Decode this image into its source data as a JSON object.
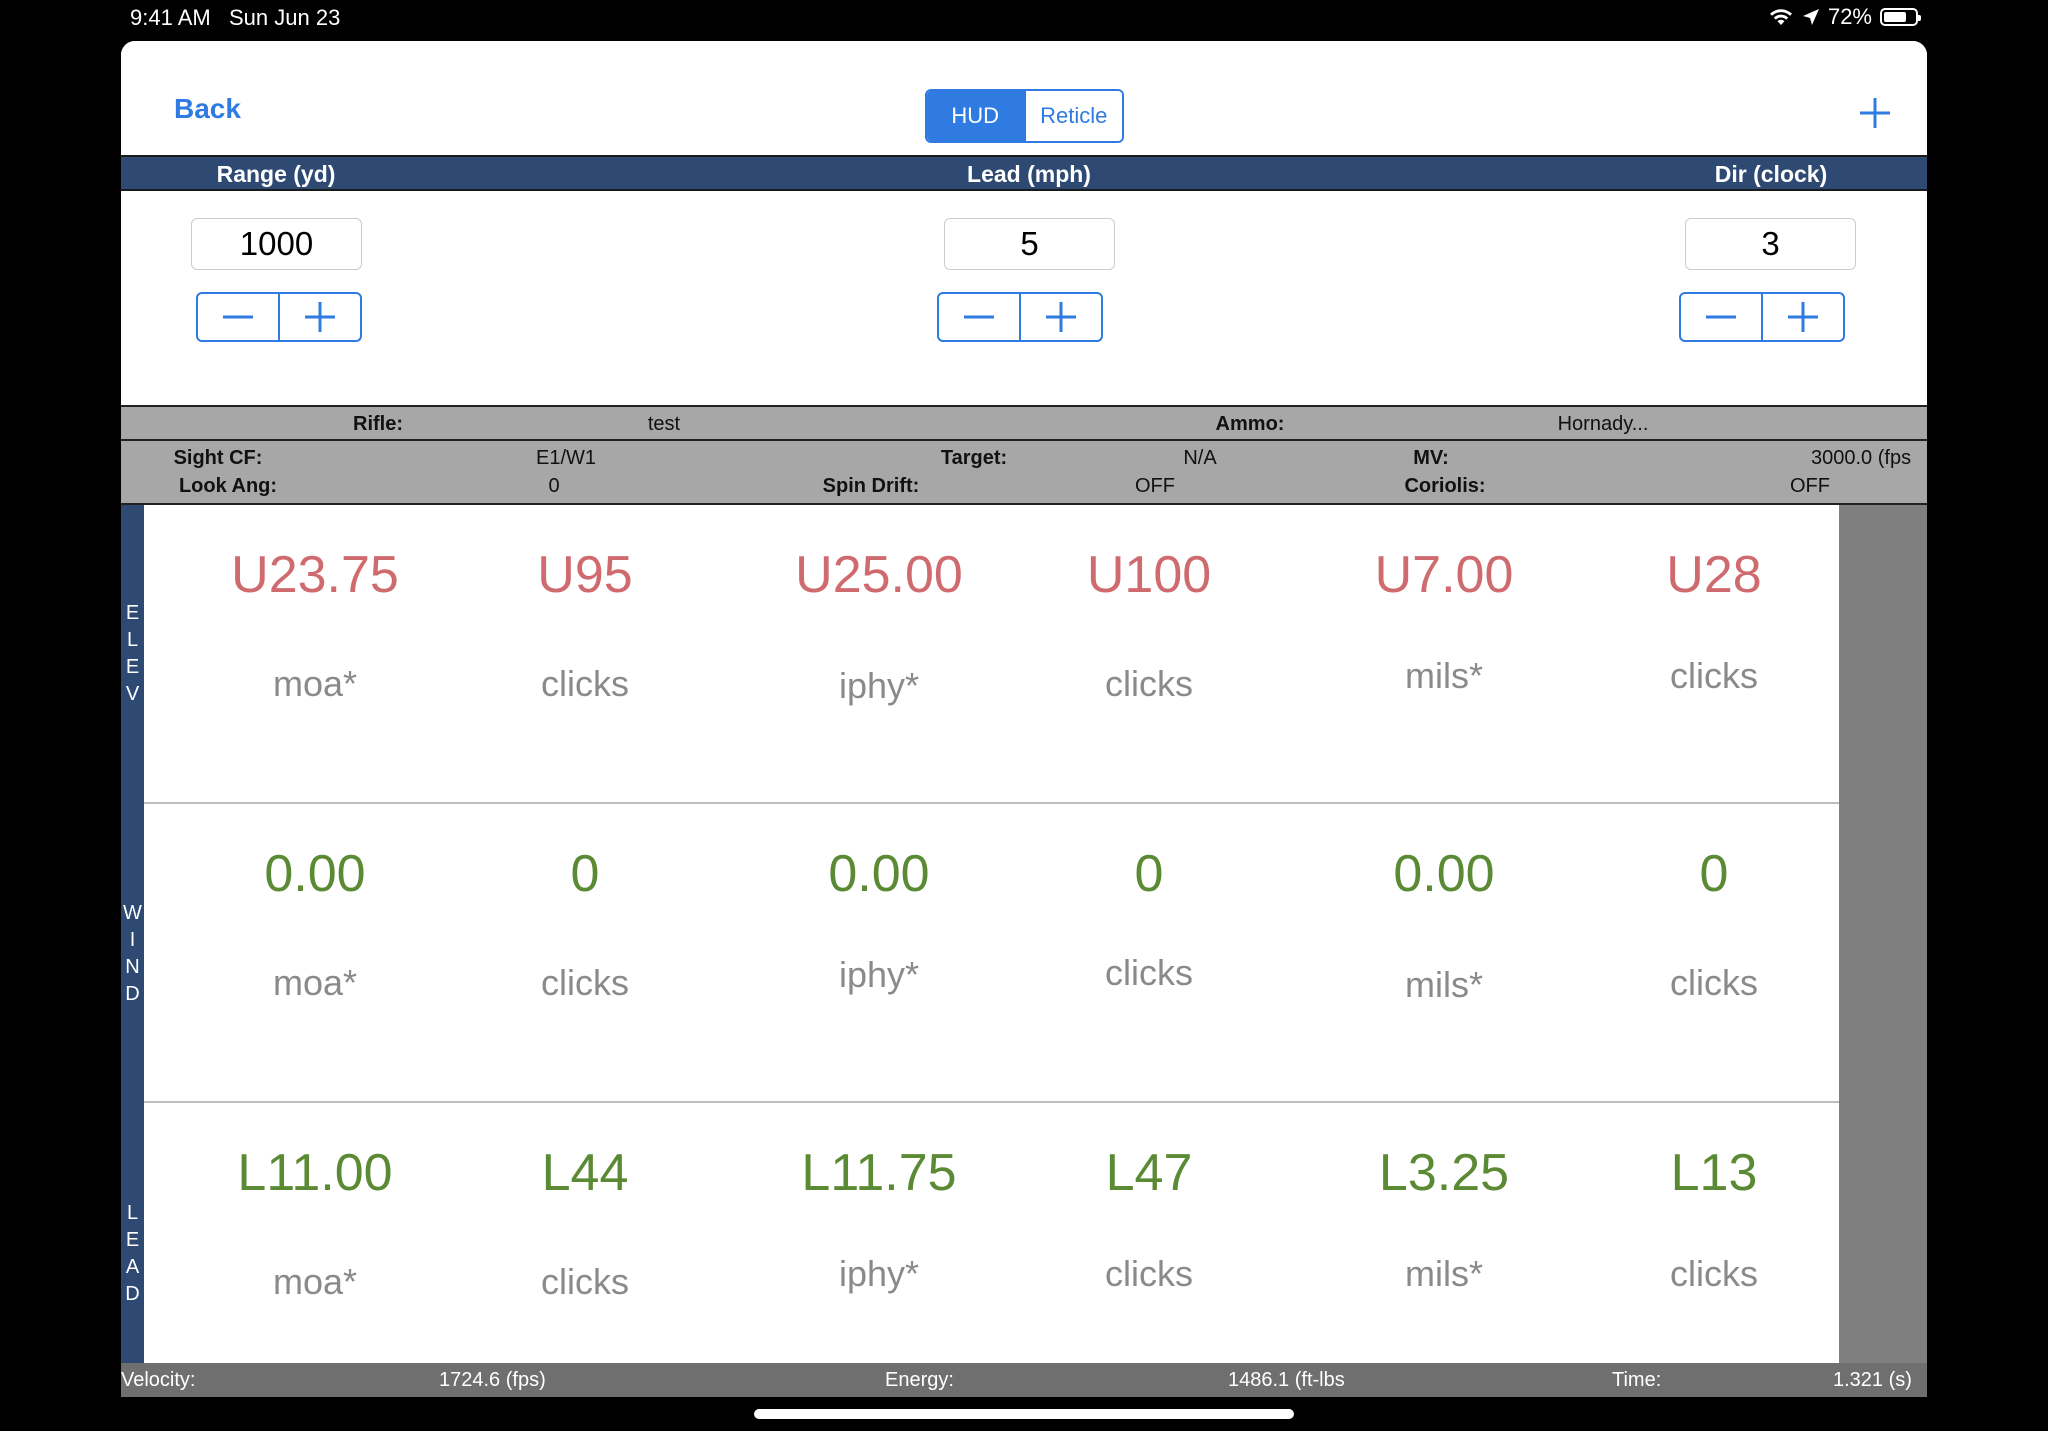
{
  "status_bar": {
    "time": "9:41 AM",
    "date": "Sun Jun 23",
    "battery": "72%",
    "battery_level": 0.72
  },
  "nav": {
    "back_label": "Back",
    "segments": [
      "HUD",
      "Reticle"
    ],
    "selected_segment": "HUD",
    "add_icon": "plus-icon"
  },
  "inputs": {
    "range": {
      "label": "Range (yd)",
      "value": "1000"
    },
    "lead": {
      "label": "Lead (mph)",
      "value": "5"
    },
    "dir": {
      "label": "Dir (clock)",
      "value": "3"
    }
  },
  "info": {
    "rifle_label": "Rifle:",
    "rifle_value": "test",
    "ammo_label": "Ammo:",
    "ammo_value": "Hornady...",
    "sight_cf_label": "Sight CF:",
    "sight_cf_value": "E1/W1",
    "target_label": "Target:",
    "target_value": "N/A",
    "mv_label": "MV:",
    "mv_value": "3000.0 (fps",
    "look_ang_label": "Look Ang:",
    "look_ang_value": "0",
    "spin_drift_label": "Spin Drift:",
    "spin_drift_value": "OFF",
    "coriolis_label": "Coriolis:",
    "coriolis_value": "OFF"
  },
  "rows": [
    {
      "label": "ELEV",
      "letters": [
        "E",
        "L",
        "E",
        "V"
      ],
      "cells": [
        {
          "value": "U23.75",
          "unit": "moa*"
        },
        {
          "value": "U95",
          "unit": "clicks"
        },
        {
          "value": "U25.00",
          "unit": "iphy*"
        },
        {
          "value": "U100",
          "unit": "clicks"
        },
        {
          "value": "U7.00",
          "unit": "mils*"
        },
        {
          "value": "U28",
          "unit": "clicks"
        }
      ]
    },
    {
      "label": "WIND",
      "letters": [
        "W",
        "I",
        "N",
        "D"
      ],
      "cells": [
        {
          "value": "0.00",
          "unit": "moa*"
        },
        {
          "value": "0",
          "unit": "clicks"
        },
        {
          "value": "0.00",
          "unit": "iphy*"
        },
        {
          "value": "0",
          "unit": "clicks"
        },
        {
          "value": "0.00",
          "unit": "mils*"
        },
        {
          "value": "0",
          "unit": "clicks"
        }
      ]
    },
    {
      "label": "LEAD",
      "letters": [
        "L",
        "E",
        "A",
        "D"
      ],
      "cells": [
        {
          "value": "L11.00",
          "unit": "moa*"
        },
        {
          "value": "L44",
          "unit": "clicks"
        },
        {
          "value": "L11.75",
          "unit": "iphy*"
        },
        {
          "value": "L47",
          "unit": "clicks"
        },
        {
          "value": "L3.25",
          "unit": "mils*"
        },
        {
          "value": "L13",
          "unit": "clicks"
        }
      ]
    }
  ],
  "footer": {
    "velocity_label": "Velocity:",
    "velocity_value": "1724.6 (fps)",
    "energy_label": "Energy:",
    "energy_value": "1486.1 (ft-lbs",
    "time_label": "Time:",
    "time_value": "1.321 (s)"
  },
  "colors": {
    "accent": "#2f7be2",
    "header": "#2e4a73",
    "elev": "#cf6b6f",
    "wind_lead": "#5b8a34",
    "info_bg": "#a7a7a7"
  }
}
